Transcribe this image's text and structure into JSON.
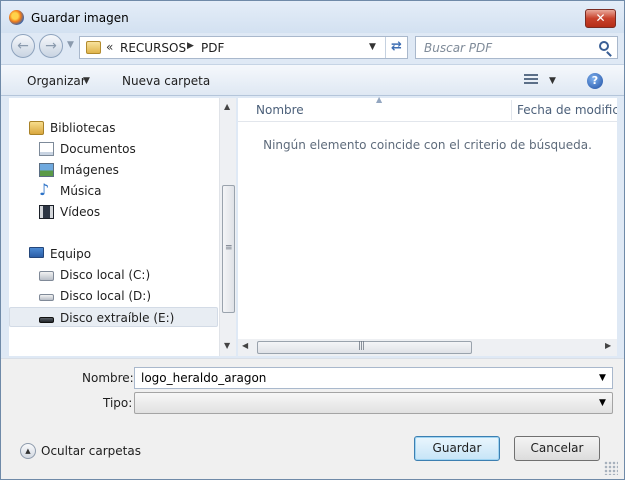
{
  "window": {
    "title": "Guardar imagen",
    "close_label": "✕"
  },
  "address": {
    "root_marker": "«",
    "crumbs": [
      "RECURSOS",
      "PDF"
    ]
  },
  "search": {
    "placeholder": "Buscar PDF"
  },
  "toolbar": {
    "organize_label": "Organizar",
    "new_folder_label": "Nueva carpeta",
    "help_label": "?"
  },
  "nav": {
    "items": [
      {
        "label": "Bibliotecas",
        "icon": "library-icon"
      },
      {
        "label": "Documentos",
        "icon": "documents-icon"
      },
      {
        "label": "Imágenes",
        "icon": "pictures-icon"
      },
      {
        "label": "Música",
        "icon": "music-icon"
      },
      {
        "label": "Vídeos",
        "icon": "videos-icon"
      },
      {
        "label": "Equipo",
        "icon": "computer-icon"
      },
      {
        "label": "Disco local (C:)",
        "icon": "drive-c-icon"
      },
      {
        "label": "Disco local (D:)",
        "icon": "drive-d-icon"
      },
      {
        "label": "Disco extraíble (E:)",
        "icon": "removable-drive-icon"
      }
    ],
    "selected": "Disco extraíble (E:)"
  },
  "filelist": {
    "columns": [
      "Nombre",
      "Fecha de modifica..."
    ],
    "empty_message": "Ningún elemento coincide con el criterio de búsqueda."
  },
  "form": {
    "name_label": "Nombre:",
    "name_value": "logo_heraldo_aragon",
    "type_label": "Tipo:",
    "type_value": ""
  },
  "footer": {
    "hide_folders_label": "Ocultar carpetas",
    "save_label": "Guardar",
    "cancel_label": "Cancelar"
  },
  "colors": {
    "accent": "#3c7fb1",
    "window_bg": "#dfe9f5",
    "close": "#c8412b"
  }
}
